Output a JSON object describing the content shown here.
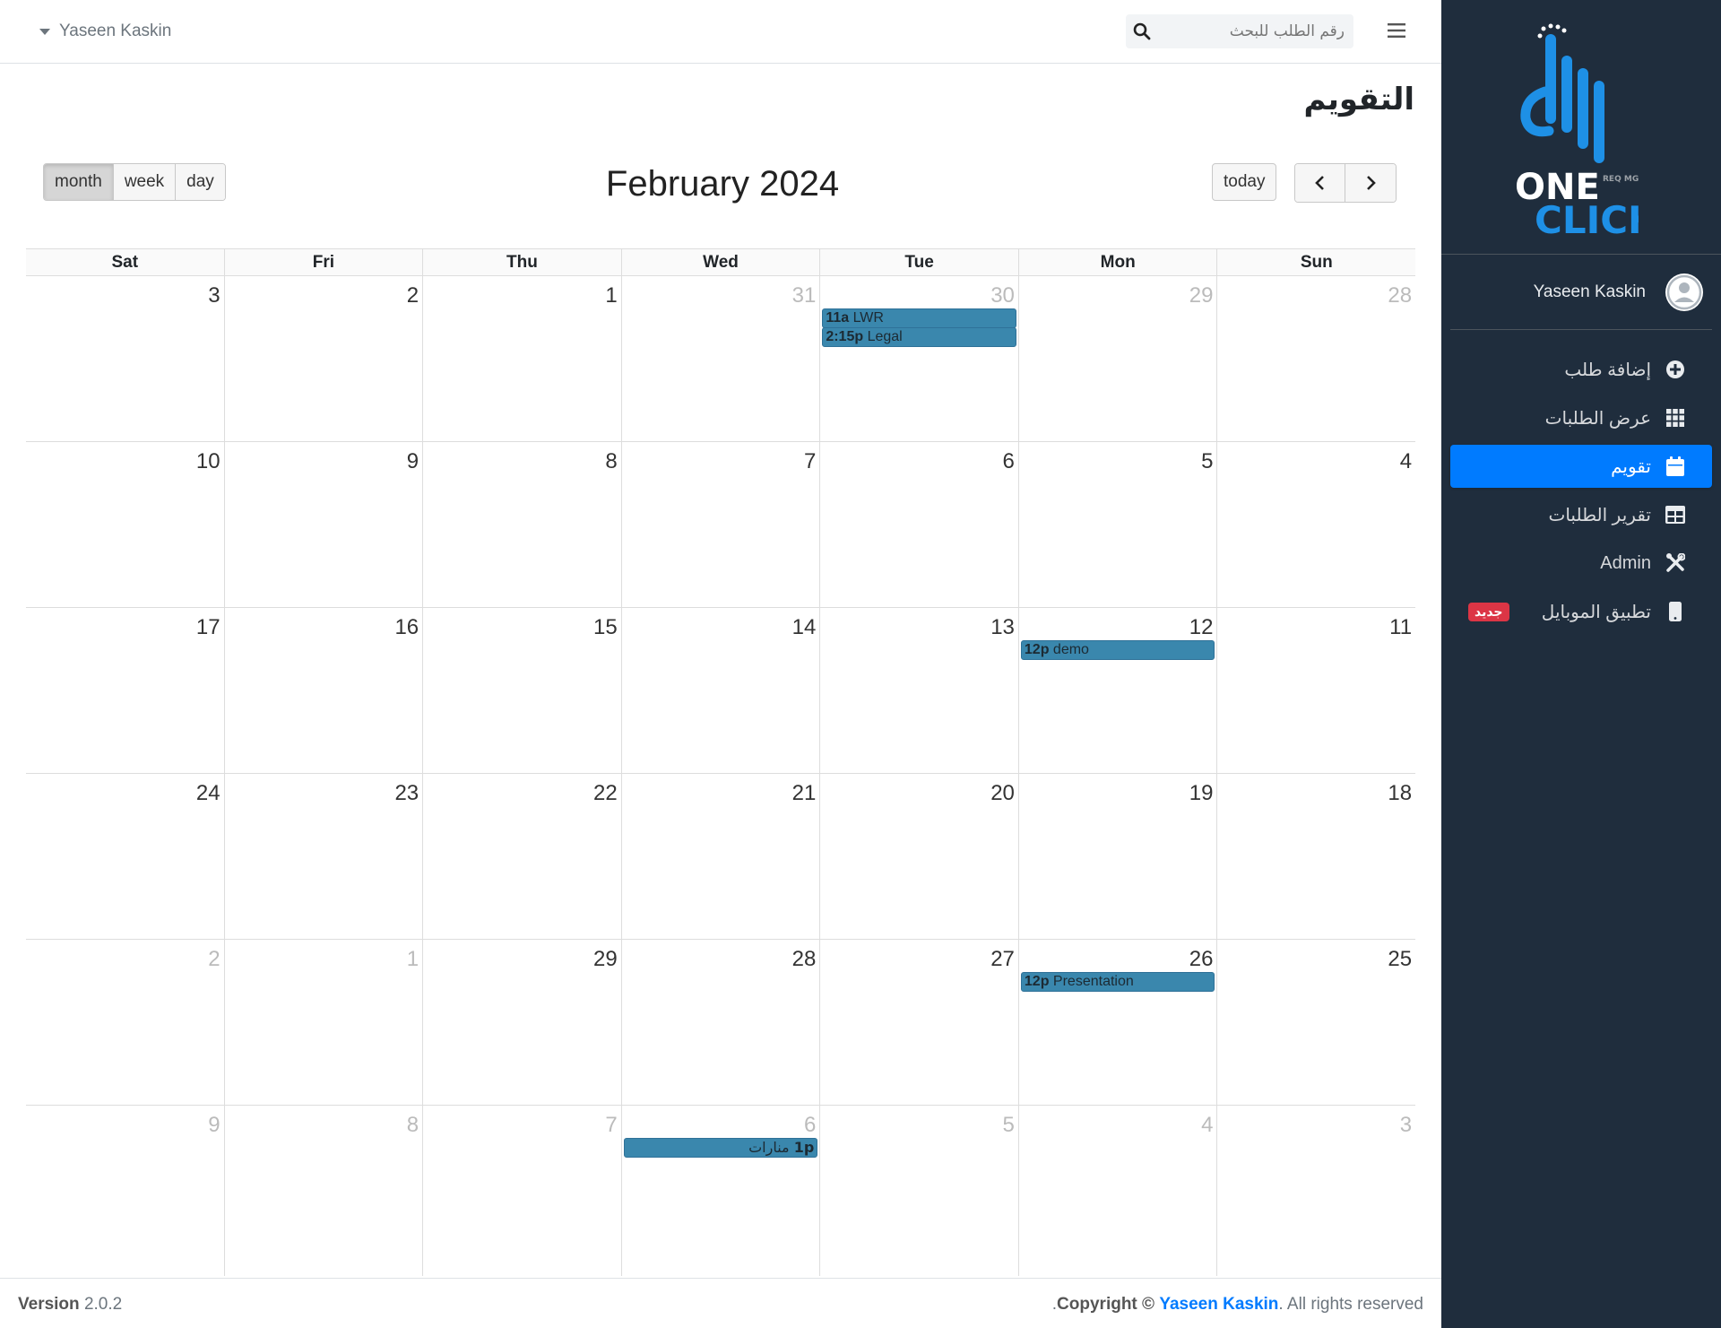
{
  "topbar": {
    "user_name": "Yaseen Kaskin",
    "search_placeholder": "رقم الطلب للبحث"
  },
  "sidebar": {
    "brand": {
      "line1": "ONE",
      "line2": "CLICK",
      "sub": "REQ MGT"
    },
    "user_name": "Yaseen Kaskin",
    "items": [
      {
        "label": "إضافة طلب",
        "icon": "plus-circle-icon",
        "active": false
      },
      {
        "label": "عرض الطلبات",
        "icon": "grid-icon",
        "active": false
      },
      {
        "label": "تقويم",
        "icon": "calendar-icon",
        "active": true
      },
      {
        "label": "تقرير الطلبات",
        "icon": "table-icon",
        "active": false
      },
      {
        "label": "Admin",
        "icon": "tools-icon",
        "active": false
      },
      {
        "label": "تطبيق الموبايل",
        "icon": "mobile-icon",
        "active": false,
        "badge": "جديد"
      }
    ],
    "accent": "#007bff"
  },
  "page": {
    "title": "التقويم"
  },
  "calendar": {
    "title": "February 2024",
    "views": [
      "month",
      "week",
      "day"
    ],
    "active_view": "month",
    "today_label": "today",
    "days_of_week": [
      "Sat",
      "Fri",
      "Thu",
      "Wed",
      "Tue",
      "Mon",
      "Sun"
    ],
    "weeks": [
      [
        {
          "n": "3"
        },
        {
          "n": "2"
        },
        {
          "n": "1"
        },
        {
          "n": "31",
          "o": true
        },
        {
          "n": "30",
          "o": true,
          "ev": [
            {
              "t": "11a",
              "l": "LWR"
            },
            {
              "t": "2:15p",
              "l": "Legal"
            }
          ]
        },
        {
          "n": "29",
          "o": true
        },
        {
          "n": "28",
          "o": true
        }
      ],
      [
        {
          "n": "10"
        },
        {
          "n": "9"
        },
        {
          "n": "8"
        },
        {
          "n": "7"
        },
        {
          "n": "6"
        },
        {
          "n": "5"
        },
        {
          "n": "4"
        }
      ],
      [
        {
          "n": "17"
        },
        {
          "n": "16"
        },
        {
          "n": "15"
        },
        {
          "n": "14"
        },
        {
          "n": "13"
        },
        {
          "n": "12",
          "ev": [
            {
              "t": "12p",
              "l": "demo"
            }
          ]
        },
        {
          "n": "11"
        }
      ],
      [
        {
          "n": "24"
        },
        {
          "n": "23"
        },
        {
          "n": "22"
        },
        {
          "n": "21"
        },
        {
          "n": "20"
        },
        {
          "n": "19"
        },
        {
          "n": "18"
        }
      ],
      [
        {
          "n": "2",
          "o": true
        },
        {
          "n": "1",
          "o": true
        },
        {
          "n": "29"
        },
        {
          "n": "28"
        },
        {
          "n": "27"
        },
        {
          "n": "26",
          "ev": [
            {
              "t": "12p",
              "l": "Presentation"
            }
          ]
        },
        {
          "n": "25"
        }
      ],
      [
        {
          "n": "9",
          "o": true
        },
        {
          "n": "8",
          "o": true
        },
        {
          "n": "7",
          "o": true
        },
        {
          "n": "6",
          "o": true,
          "ev": [
            {
              "t": "1p",
              "l": "منارات",
              "rtl": true
            }
          ]
        },
        {
          "n": "5",
          "o": true
        },
        {
          "n": "4",
          "o": true
        },
        {
          "n": "3",
          "o": true
        }
      ]
    ],
    "event_color": "#3a87ad"
  },
  "footer": {
    "version_label": "Version",
    "version": "2.0.2",
    "copyright_label": "Copyright ©",
    "author": "Yaseen Kaskin",
    "rights": ". All rights reserved",
    "trailing_dot": "."
  }
}
